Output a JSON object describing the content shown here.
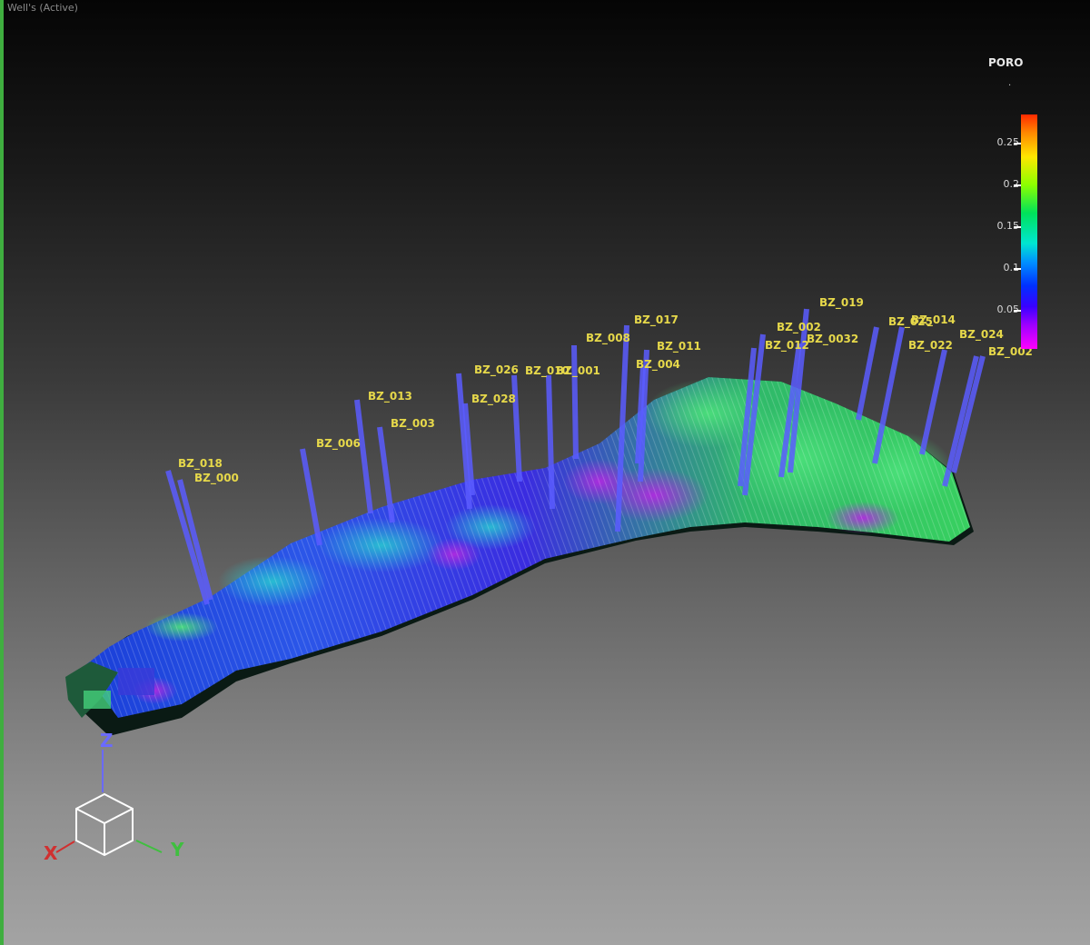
{
  "window": {
    "title": "Well's (Active)"
  },
  "legend": {
    "property": "PORO",
    "dot": ".",
    "ticks": [
      "0.25",
      "0.2",
      "0.15",
      "0.1",
      "0.05"
    ]
  },
  "wells": [
    {
      "name": "BZ_018"
    },
    {
      "name": "BZ_000"
    },
    {
      "name": "BZ_006"
    },
    {
      "name": "BZ_013"
    },
    {
      "name": "BZ_003"
    },
    {
      "name": "BZ_026"
    },
    {
      "name": "BZ_028"
    },
    {
      "name": "BZ_010"
    },
    {
      "name": "BZ_001"
    },
    {
      "name": "BZ_008"
    },
    {
      "name": "BZ_017"
    },
    {
      "name": "BZ_011"
    },
    {
      "name": "BZ_004"
    },
    {
      "name": "BZ_019"
    },
    {
      "name": "BZ_002"
    },
    {
      "name": "BZ_012"
    },
    {
      "name": "BZ_0032"
    },
    {
      "name": "BZ_025"
    },
    {
      "name": "BZ_014"
    },
    {
      "name": "BZ_022"
    },
    {
      "name": "BZ_024"
    },
    {
      "name": "BZ_002"
    }
  ],
  "axes": {
    "z": "Z",
    "x": "X",
    "y": "Y"
  },
  "colors": {
    "active_border": "#3fae3f",
    "well_stick": "#5a5cff",
    "well_label": "#e6d84a"
  }
}
